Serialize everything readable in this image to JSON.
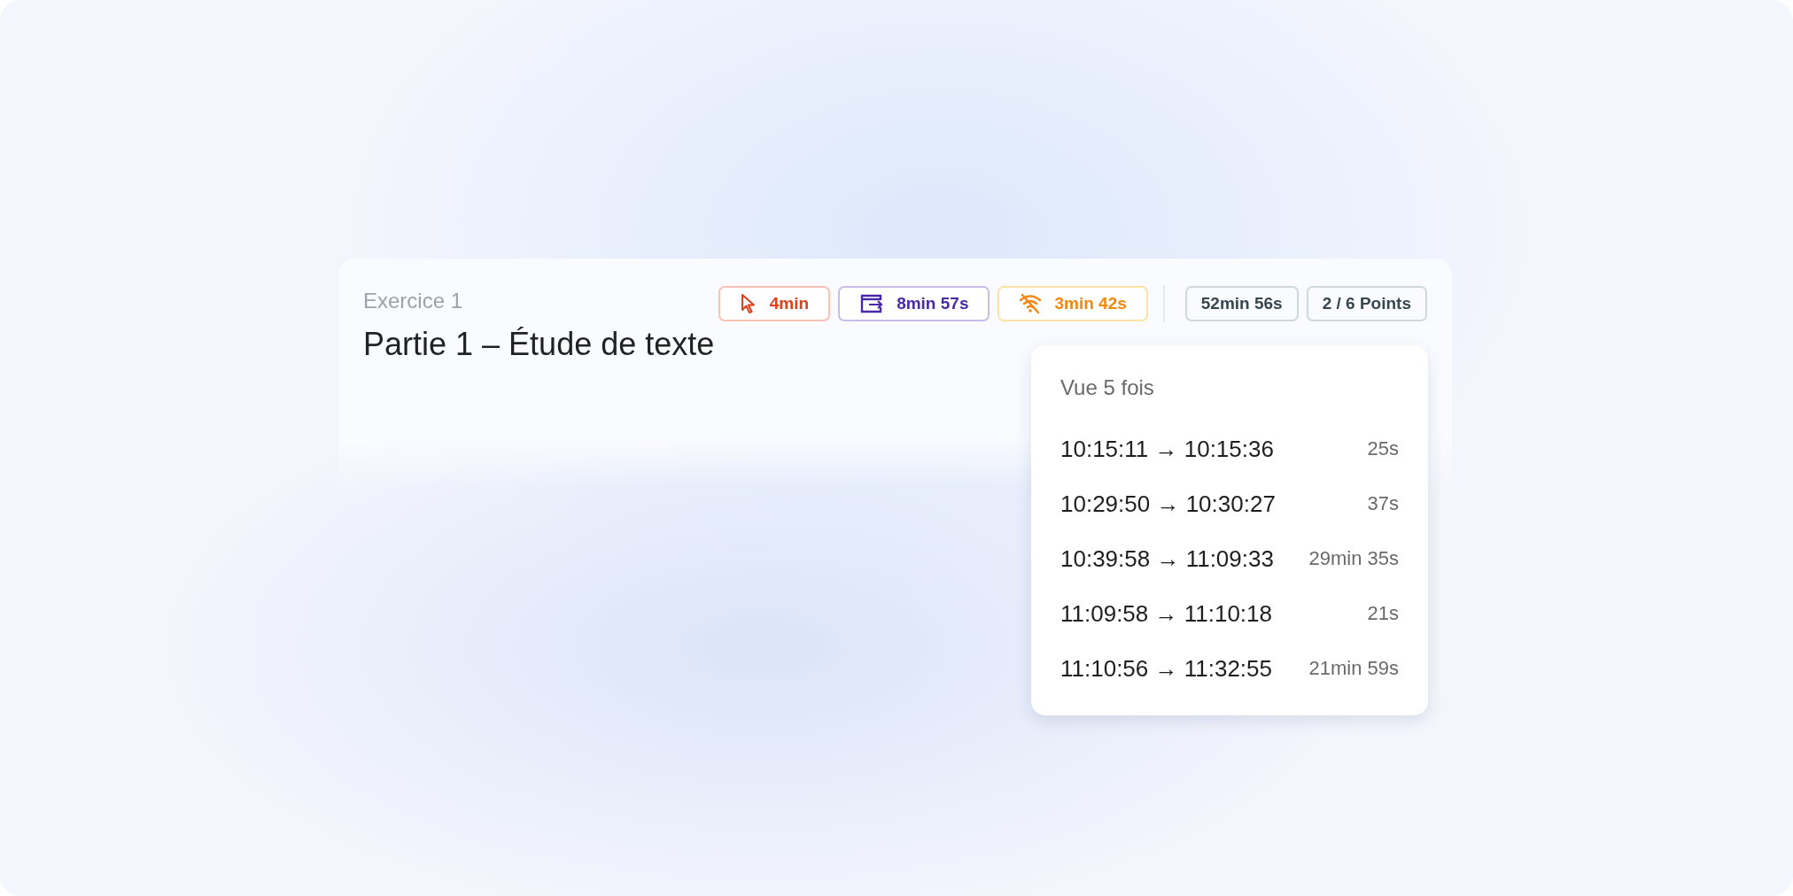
{
  "exercise": {
    "label": "Exercice 1",
    "title": "Partie 1 – Étude de texte"
  },
  "badges": [
    {
      "kind": "click",
      "text": "4min",
      "color": "#e0401a"
    },
    {
      "kind": "exit",
      "text": "8min 57s",
      "color": "#4a2aa8"
    },
    {
      "kind": "offline",
      "text": "3min 42s",
      "color": "#f5870f"
    },
    {
      "kind": "plain",
      "text": "52min 56s",
      "color": "#37474f"
    },
    {
      "kind": "plain",
      "text": "2 / 6 Points",
      "color": "#37474f"
    }
  ],
  "popover": {
    "title": "Vue 5 fois",
    "views": [
      {
        "range": "10:15:11 → 10:15:36",
        "duration": "25s"
      },
      {
        "range": "10:29:50 → 10:30:27",
        "duration": "37s"
      },
      {
        "range": "10:39:58 → 11:09:33",
        "duration": "29min 35s"
      },
      {
        "range": "11:09:58 → 11:10:18",
        "duration": "21s"
      },
      {
        "range": "11:10:56 → 11:32:55",
        "duration": "21min 59s"
      }
    ]
  }
}
